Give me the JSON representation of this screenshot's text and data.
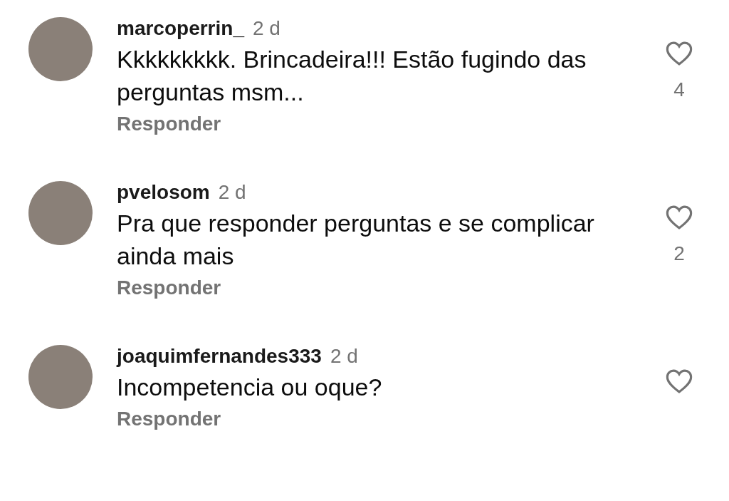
{
  "comments": [
    {
      "username": "marcoperrin_",
      "time": "2 d",
      "text": "Kkkkkkkkk. Brincadeira!!! Estão fugindo das perguntas msm...",
      "reply": "Responder",
      "liked": false,
      "likes": "4"
    },
    {
      "username": "pvelosom",
      "time": "2 d",
      "text": "Pra que responder perguntas e se complicar ainda mais",
      "reply": "Responder",
      "liked": false,
      "likes": "2"
    },
    {
      "username": "joaquimfernandes333",
      "time": "2 d",
      "text": "Incompetencia  ou  oque?",
      "reply": "Responder",
      "liked": false
    }
  ]
}
